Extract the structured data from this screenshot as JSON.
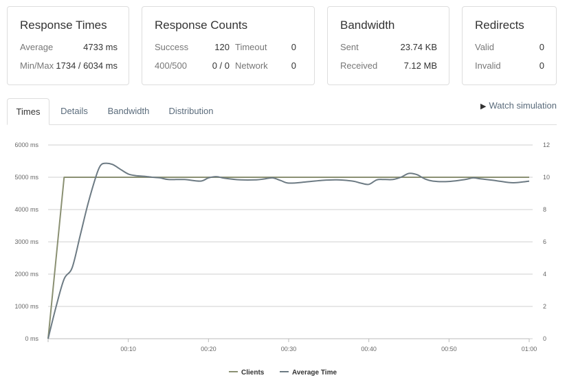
{
  "cards": {
    "response_times": {
      "title": "Response Times",
      "average_label": "Average",
      "average_value": "4733 ms",
      "minmax_label": "Min/Max",
      "minmax_value": "1734 / 6034 ms"
    },
    "response_counts": {
      "title": "Response Counts",
      "success_label": "Success",
      "success_value": "120",
      "timeout_label": "Timeout",
      "timeout_value": "0",
      "err_label": "400/500",
      "err_value": "0 / 0",
      "network_label": "Network",
      "network_value": "0"
    },
    "bandwidth": {
      "title": "Bandwidth",
      "sent_label": "Sent",
      "sent_value": "23.74 KB",
      "received_label": "Received",
      "received_value": "7.12 MB"
    },
    "redirects": {
      "title": "Redirects",
      "valid_label": "Valid",
      "valid_value": "0",
      "invalid_label": "Invalid",
      "invalid_value": "0"
    }
  },
  "tabs": [
    {
      "label": "Times",
      "active": true
    },
    {
      "label": "Details",
      "active": false
    },
    {
      "label": "Bandwidth",
      "active": false
    },
    {
      "label": "Distribution",
      "active": false
    }
  ],
  "watch_simulation": {
    "icon": "play-icon",
    "label": "Watch simulation"
  },
  "colors": {
    "clients": "#8a9072",
    "average_time": "#6c7a83",
    "grid": "#cfcfcf",
    "axis_text": "#666666"
  },
  "chart_data": {
    "type": "line",
    "x_ticks": [
      "00:10",
      "00:20",
      "00:30",
      "00:40",
      "00:50",
      "01:00"
    ],
    "xlim": [
      0,
      60
    ],
    "y_left_ticks": [
      "0 ms",
      "1000 ms",
      "2000 ms",
      "3000 ms",
      "4000 ms",
      "5000 ms",
      "6000 ms"
    ],
    "y_left_range": [
      0,
      6000
    ],
    "y_right_ticks": [
      "0",
      "2",
      "4",
      "6",
      "8",
      "10",
      "12"
    ],
    "y_right_range": [
      0,
      12
    ],
    "legend_position": "bottom-center",
    "grid": true,
    "series": [
      {
        "name": "Clients",
        "axis": "right",
        "x": [
          0,
          2,
          5,
          10,
          20,
          30,
          40,
          50,
          60
        ],
        "y": [
          0,
          10,
          10,
          10,
          10,
          10,
          10,
          10,
          10
        ]
      },
      {
        "name": "Average Time",
        "axis": "left",
        "x": [
          0,
          1,
          2,
          3,
          4,
          5,
          6,
          6.5,
          7,
          8,
          9,
          10,
          11,
          12,
          13,
          14,
          15,
          17,
          19,
          20,
          21,
          22,
          24,
          26,
          27,
          28,
          29,
          30,
          32,
          34,
          36,
          38,
          39,
          40,
          41,
          42,
          43,
          44,
          45,
          46,
          47,
          48,
          50,
          52,
          53,
          54,
          56,
          58,
          60
        ],
        "y": [
          0,
          1000,
          1850,
          2200,
          3200,
          4200,
          5050,
          5350,
          5430,
          5400,
          5250,
          5100,
          5050,
          5030,
          5000,
          4980,
          4930,
          4930,
          4880,
          4980,
          5020,
          4970,
          4920,
          4920,
          4950,
          4980,
          4900,
          4820,
          4850,
          4900,
          4920,
          4880,
          4820,
          4780,
          4920,
          4930,
          4930,
          5000,
          5120,
          5080,
          4950,
          4880,
          4870,
          4930,
          4980,
          4950,
          4890,
          4830,
          4880
        ]
      }
    ]
  }
}
